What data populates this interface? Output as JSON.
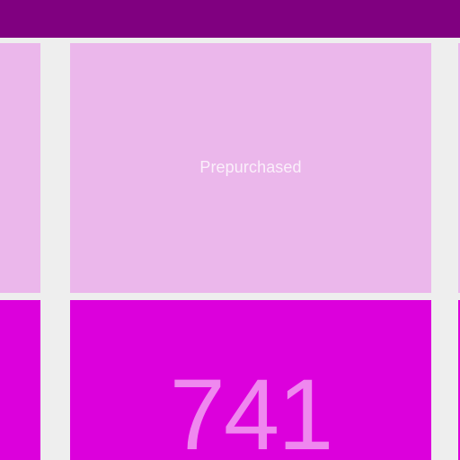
{
  "theme": {
    "header_color": "#800080",
    "background_color": "#eeeeee",
    "light_tile_color": "#ebb7eb",
    "strong_tile_color": "#dc00dc",
    "number_color": "#ef88ef"
  },
  "tiles": {
    "top_center": {
      "label": "Prepurchased"
    },
    "bottom_center": {
      "value": "741"
    }
  }
}
